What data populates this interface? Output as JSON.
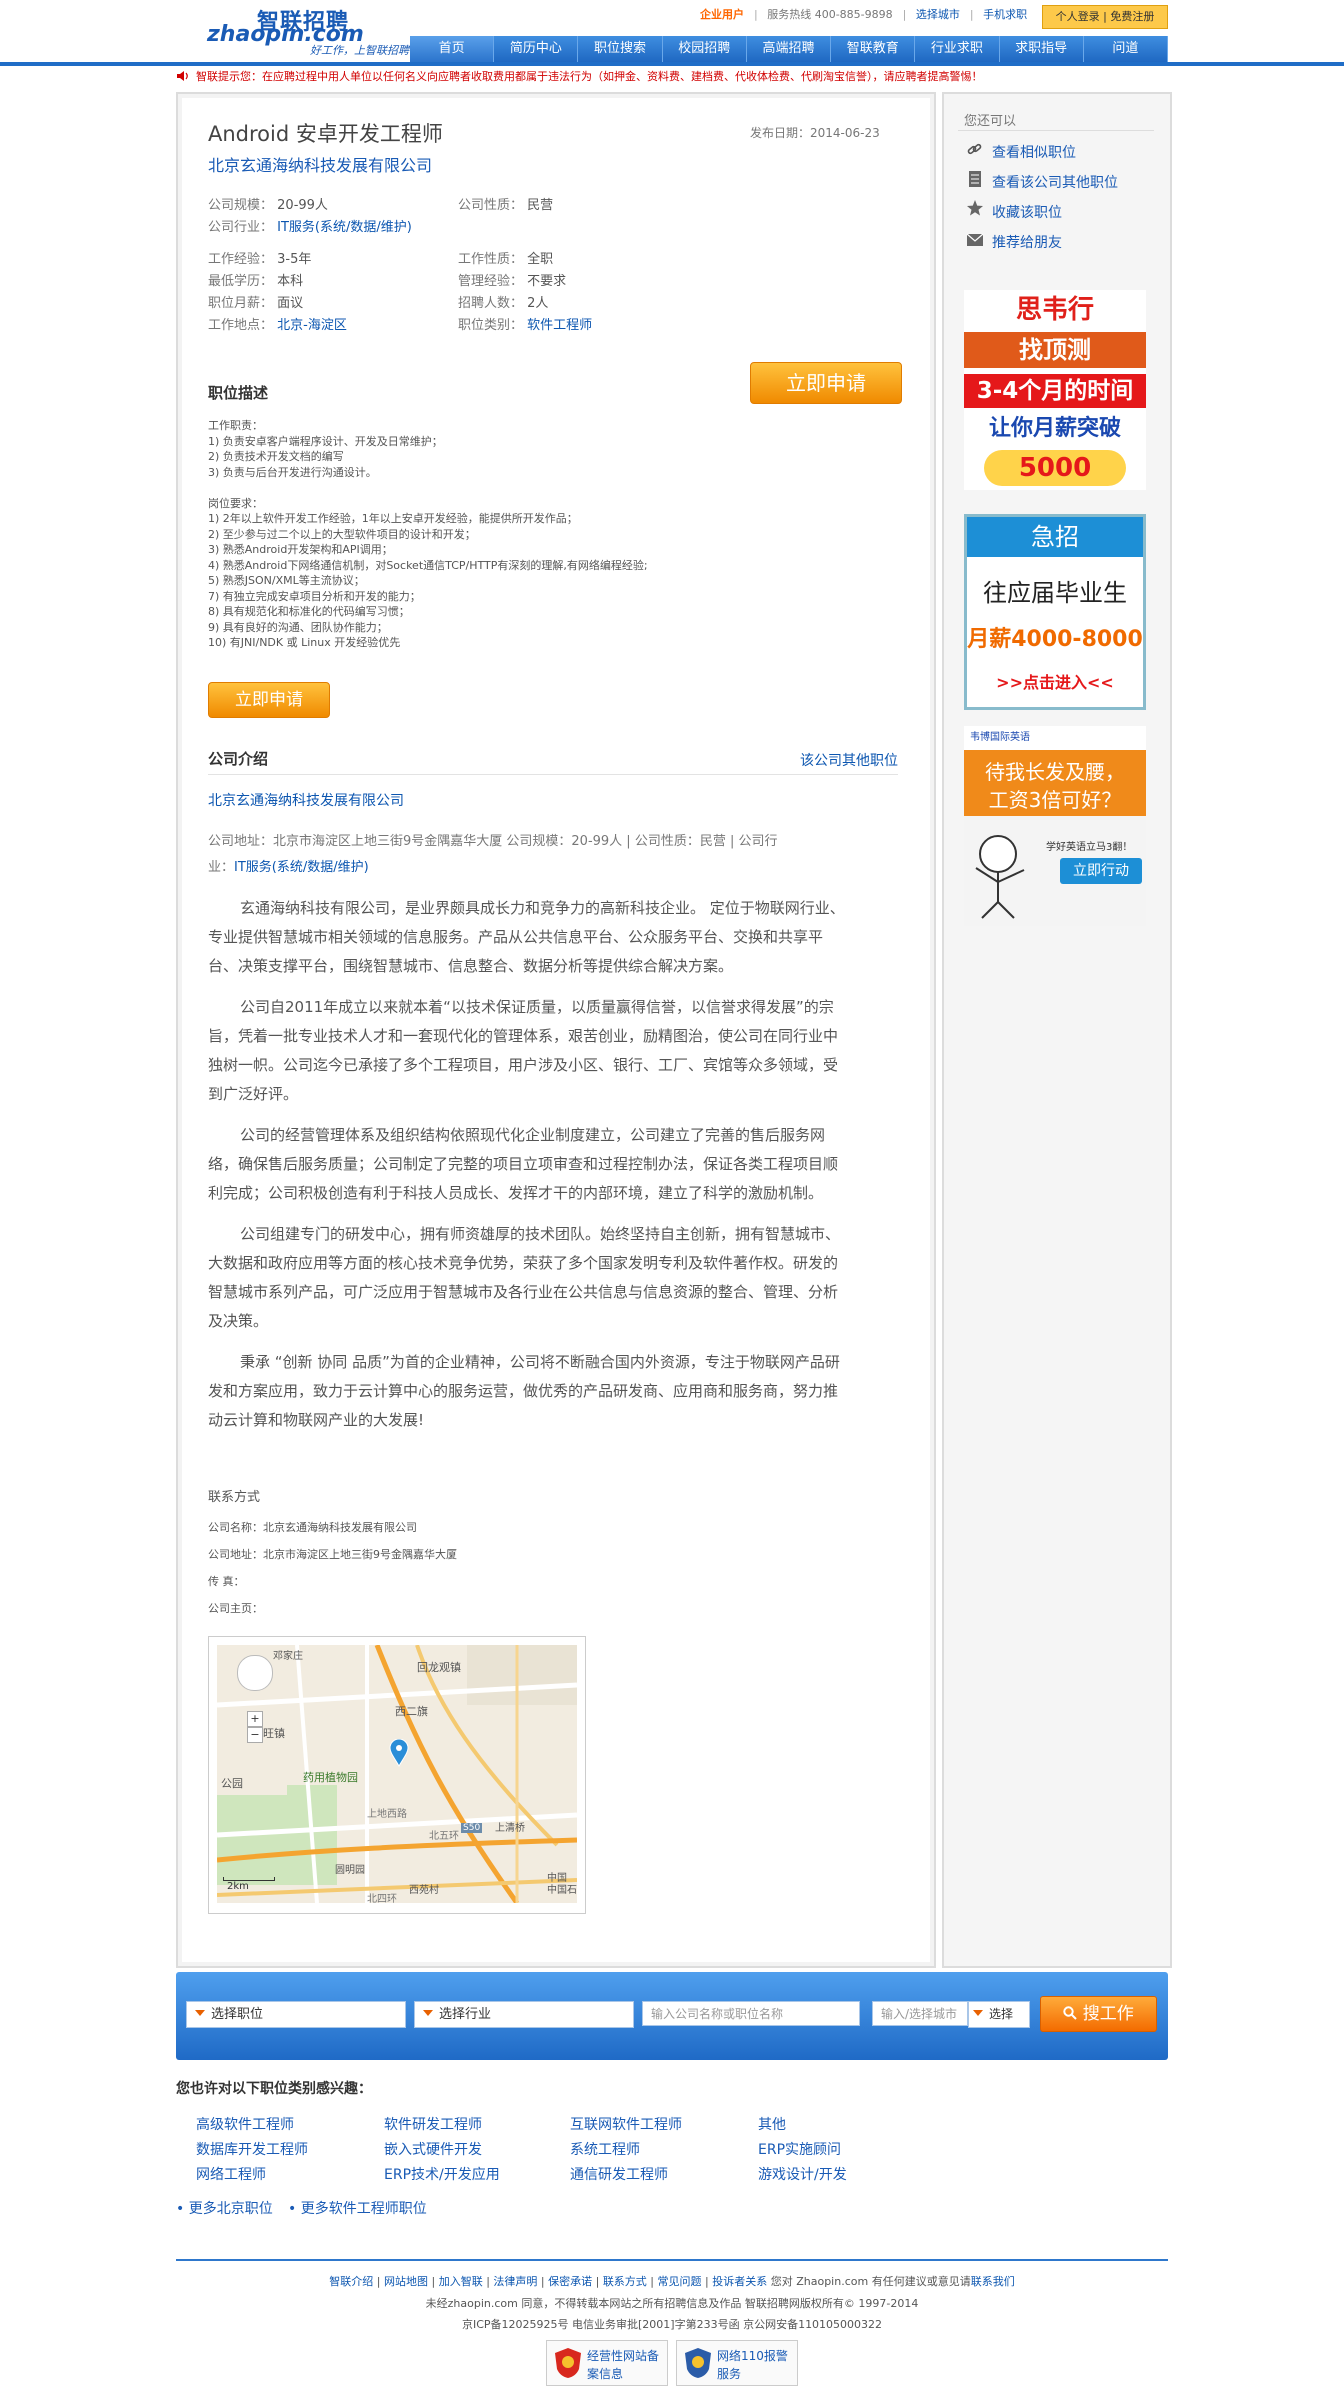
{
  "header": {
    "logo_cn": "智联招聘",
    "logo_en": "zhaopin.com",
    "slogan": "好工作，上智联招聘",
    "enterprise": "企业用户",
    "hotline": "服务热线 400-885-9898",
    "city": "选择城市",
    "mobile": "手机求职",
    "login": "个人登录",
    "register": "免费注册",
    "nav": [
      "首页",
      "简历中心",
      "职位搜索",
      "校园招聘",
      "高端招聘",
      "智联教育",
      "行业求职",
      "求职指导",
      "问道"
    ]
  },
  "notice": "智联提示您：在应聘过程中用人单位以任何名义向应聘者收取费用都属于违法行为（如押金、资料费、建档费、代收体检费、代刷淘宝信誉），请应聘者提高警惕！",
  "job": {
    "title": "Android 安卓开发工程师",
    "company": "北京玄通海纳科技发展有限公司",
    "publish_label": "发布日期：",
    "publish_date": "2014-06-23",
    "scale_label": "公司规模：",
    "scale": "20-99人",
    "nature_label": "公司性质：",
    "nature": "民营",
    "industry_label": "公司行业：",
    "industry": "IT服务(系统/数据/维护)",
    "exp_label": "工作经验：",
    "exp": "3-5年",
    "type_label": "工作性质：",
    "type": "全职",
    "edu_label": "最低学历：",
    "edu": "本科",
    "mgmt_label": "管理经验：",
    "mgmt": "不要求",
    "salary_label": "职位月薪：",
    "salary": "面议",
    "count_label": "招聘人数：",
    "count": "2人",
    "place_label": "工作地点：",
    "place": "北京-海淀区",
    "cat_label": "职位类别：",
    "cat": "软件工程师",
    "apply_big": "立即申请",
    "apply_small": "立即申请",
    "desc_heading": "职位描述",
    "desc_lines": [
      "工作职责：",
      "1)        负责安卓客户端程序设计、开发及日常维护；",
      "2)        负责技术开发文档的编写",
      "3)        负责与后台开发进行沟通设计。",
      "",
      "岗位要求：",
      "1)        2年以上软件开发工作经验，1年以上安卓开发经验，能提供所开发作品；",
      "2)        至少参与过二个以上的大型软件项目的设计和开发；",
      "3)        熟悉Android开发架构和API调用；",
      "4)        熟悉Android下网络通信机制，对Socket通信TCP/HTTP有深刻的理解,有网络编程经验;",
      "5)        熟悉JSON/XML等主流协议；",
      "7)        有独立完成安卓项目分析和开发的能力；",
      "8)        具有规范化和标准化的代码编写习惯；",
      "9)        具有良好的沟通、团队协作能力；",
      "10)       有JNI/NDK 或 Linux 开发经验优先"
    ]
  },
  "company_section": {
    "heading": "公司介绍",
    "other_jobs": "该公司其他职位",
    "name": "北京玄通海纳科技发展有限公司",
    "addr_line1": "公司地址：北京市海淀区上地三街9号金隅嘉华大厦  公司规模：20-99人  |  公司性质：民营  |  公司行",
    "addr_line2_prefix": "业：",
    "addr_line2_link": "IT服务(系统/数据/维护)",
    "paragraphs": [
      "玄通海纳科技有限公司，是业界颇具成长力和竞争力的高新科技企业。 定位于物联网行业、专业提供智慧城市相关领域的信息服务。产品从公共信息平台、公众服务平台、交换和共享平台、决策支撑平台，围绕智慧城市、信息整合、数据分析等提供综合解决方案。",
      "公司自2011年成立以来就本着“以技术保证质量，以质量赢得信誉，以信誉求得发展”的宗旨，凭着一批专业技术人才和一套现代化的管理体系，艰苦创业，励精图治，使公司在同行业中独树一帜。公司迄今已承接了多个工程项目，用户涉及小区、银行、工厂、宾馆等众多领域，受到广泛好评。",
      "公司的经营管理体系及组织结构依照现代化企业制度建立，公司建立了完善的售后服务网络，确保售后服务质量；公司制定了完整的项目立项审查和过程控制办法，保证各类工程项目顺利完成；公司积极创造有利于科技人员成长、发挥才干的内部环境，建立了科学的激励机制。",
      "公司组建专门的研发中心，拥有师资雄厚的技术团队。始终坚持自主创新，拥有智慧城市、大数据和政府应用等方面的核心技术竞争优势，荣获了多个国家发明专利及软件著作权。研发的智慧城市系列产品，可广泛应用于智慧城市及各行业在公共信息与信息资源的整合、管理、分析及决策。",
      "秉承 “创新 协同 品质”为首的企业精神，公司将不断融合国内外资源，专注于物联网产品研发和方案应用，致力于云计算中心的服务运营，做优秀的产品研发商、应用商和服务商，努力推动云计算和物联网产业的大发展!"
    ],
    "contact_heading": "联系方式",
    "contact_name": "公司名称：北京玄通海纳科技发展有限公司",
    "contact_addr": "公司地址：北京市海淀区上地三街9号金隅嘉华大厦",
    "contact_fax": "传      真：",
    "contact_home": "公司主页："
  },
  "map": {
    "labels": [
      "邓家庄",
      "回龙观镇",
      "西二旗",
      "旺镇",
      "药用植物园",
      "公园",
      "上地西路",
      "北五环",
      "上清桥",
      "西苑村",
      "圆明园",
      "北四环",
      "S50",
      "中国",
      "2km",
      "中国石"
    ]
  },
  "sidebar": {
    "heading": "您还可以",
    "links": [
      "查看相似职位",
      "查看该公司其他职位",
      "收藏该职位",
      "推荐给朋友"
    ],
    "ad1": [
      "思韦行",
      "找顶测",
      "3-4个月的时间",
      "让你月薪突破",
      "5000"
    ],
    "ad2": [
      "急招",
      "往应届毕业生",
      "月薪4000-8000",
      ">>点击进入<<"
    ],
    "ad3": [
      "韦博国际英语",
      "待我长发及腰，",
      "工资3倍可好？",
      "学好英语立马3翻！",
      "立即行动"
    ]
  },
  "search": {
    "job_select": "选择职位",
    "industry_select": "选择行业",
    "keyword_placeholder": "输入公司名称或职位名称",
    "city_placeholder": "输入/选择城市",
    "city_button": "选择",
    "submit": "搜工作"
  },
  "related": {
    "heading": "您也许对以下职位类别感兴趣：",
    "col1": [
      "高级软件工程师",
      "数据库开发工程师",
      "网络工程师"
    ],
    "col2": [
      "软件研发工程师",
      "嵌入式硬件开发",
      "ERP技术/开发应用"
    ],
    "col3": [
      "互联网软件工程师",
      "系统工程师",
      "通信研发工程师"
    ],
    "col4": [
      "其他",
      "ERP实施顾问",
      "游戏设计/开发"
    ],
    "more1": "更多北京职位",
    "more2": "更多软件工程师职位"
  },
  "footer": {
    "links": [
      "智联介绍",
      "网站地图",
      "加入智联",
      "法律声明",
      "保密承诺",
      "联系方式",
      "常见问题",
      "投诉者关系"
    ],
    "links_tail": "您对 Zhaopin.com 有任何建议或意见请",
    "links_tail_link": "联系我们",
    "line2": "未经zhaopin.com 同意，不得转载本网站之所有招聘信息及作品 智联招聘网版权所有© 1997-2014",
    "line3": "京ICP备12025925号 电信业务审批[2001]字第233号函 京公网安备110105000322",
    "badge1": [
      "经营性网站备",
      "案信息"
    ],
    "badge2": [
      "网络110报警",
      "服务"
    ]
  }
}
